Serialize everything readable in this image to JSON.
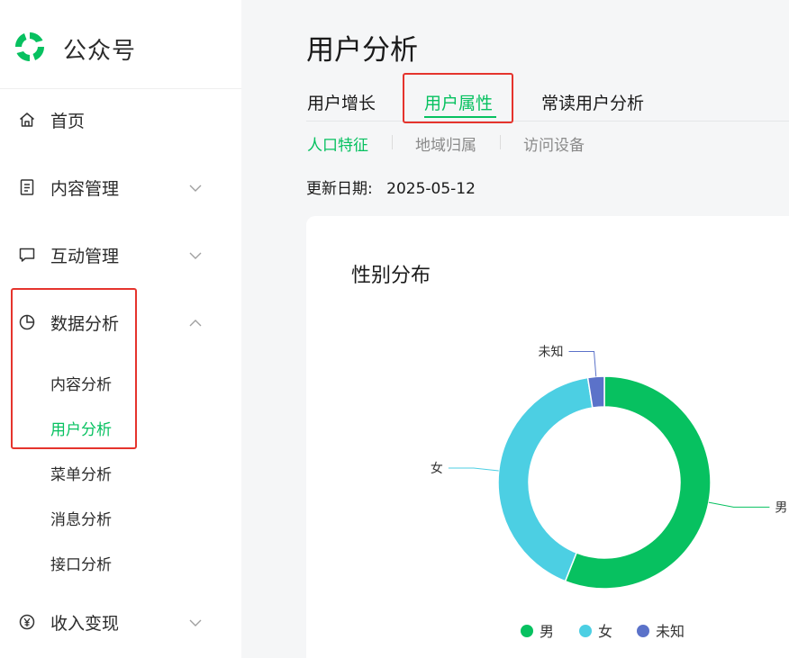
{
  "app": {
    "brand": "公众号"
  },
  "sidebar": {
    "items": [
      {
        "label": "首页",
        "icon": "home-icon"
      },
      {
        "label": "内容管理",
        "icon": "document-icon"
      },
      {
        "label": "互动管理",
        "icon": "chat-icon"
      },
      {
        "label": "数据分析",
        "icon": "pie-chart-icon"
      },
      {
        "label": "收入变现",
        "icon": "yen-icon"
      }
    ],
    "sub_items": [
      {
        "label": "内容分析"
      },
      {
        "label": "用户分析"
      },
      {
        "label": "菜单分析"
      },
      {
        "label": "消息分析"
      },
      {
        "label": "接口分析"
      }
    ],
    "active_sub": "用户分析"
  },
  "main": {
    "title": "用户分析",
    "tabs": [
      {
        "label": "用户增长"
      },
      {
        "label": "用户属性"
      },
      {
        "label": "常读用户分析"
      }
    ],
    "active_tab": "用户属性",
    "subtabs": [
      {
        "label": "人口特征"
      },
      {
        "label": "地域归属"
      },
      {
        "label": "访问设备"
      }
    ],
    "active_subtab": "人口特征",
    "update_label": "更新日期:",
    "update_date": "2025-05-12"
  },
  "colors": {
    "accent": "#07c160",
    "highlight": "#e5342d",
    "male": "#07c160",
    "female": "#4ccfe3",
    "unknown": "#5b72c9"
  },
  "chart_data": {
    "type": "pie",
    "title": "性别分布",
    "donut": true,
    "categories": [
      "男",
      "女",
      "未知"
    ],
    "values": [
      56,
      41.5,
      2.5
    ],
    "legend_position": "bottom"
  }
}
